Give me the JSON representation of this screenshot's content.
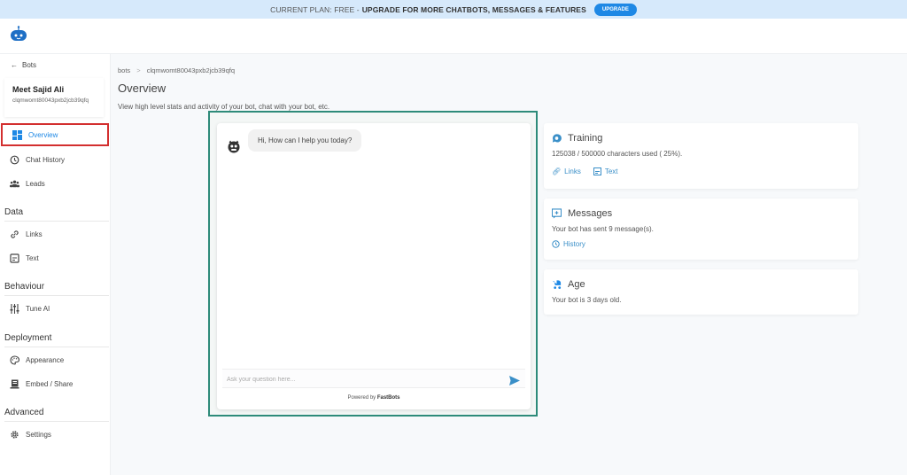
{
  "banner": {
    "plan_text": "CURRENT PLAN: FREE -",
    "upgrade_text": "UPGRADE FOR MORE CHATBOTS, MESSAGES & FEATURES",
    "upgrade_button": "UPGRADE"
  },
  "sidebar": {
    "back_label": "Bots",
    "bot_name": "Meet Sajid Ali",
    "bot_id": "clqmwomt80043pxb2jcb39qfq",
    "items": [
      {
        "label": "Overview",
        "icon": "dashboard-icon",
        "active": true
      },
      {
        "label": "Chat History",
        "icon": "history-icon"
      },
      {
        "label": "Leads",
        "icon": "people-icon"
      }
    ],
    "sections": [
      {
        "title": "Data",
        "items": [
          {
            "label": "Links",
            "icon": "link-icon"
          },
          {
            "label": "Text",
            "icon": "text-file-icon"
          }
        ]
      },
      {
        "title": "Behaviour",
        "items": [
          {
            "label": "Tune AI",
            "icon": "sliders-icon"
          }
        ]
      },
      {
        "title": "Deployment",
        "items": [
          {
            "label": "Appearance",
            "icon": "palette-icon"
          },
          {
            "label": "Embed / Share",
            "icon": "embed-icon"
          }
        ]
      },
      {
        "title": "Advanced",
        "items": [
          {
            "label": "Settings",
            "icon": "gear-icon"
          }
        ]
      }
    ]
  },
  "main": {
    "breadcrumb": {
      "root": "bots",
      "separator": ">",
      "current": "clqmwomt80043pxb2jcb39qfq"
    },
    "title": "Overview",
    "subtitle": "View high level stats and activity of your bot, chat with your bot, etc."
  },
  "chat": {
    "greeting": "Hi, How can I help you today?",
    "input_placeholder": "Ask your question here...",
    "powered_by": "Powered by",
    "brand": "FastBots"
  },
  "cards": {
    "training": {
      "title": "Training",
      "text": "125038 / 500000 characters used ( 25%).",
      "used": 125038,
      "limit": 500000,
      "percent": 25,
      "link1": "Links",
      "link2": "Text"
    },
    "messages": {
      "title": "Messages",
      "text": "Your bot has sent 9 message(s).",
      "link": "History"
    },
    "age": {
      "title": "Age",
      "text": "Your bot is 3 days old."
    }
  },
  "colors": {
    "accent": "#1e88e5",
    "link": "#3a8fc8",
    "highlight_border": "#d32f2f",
    "chat_frame_border": "#2e8b7a",
    "banner_bg": "#d6e9fb"
  }
}
